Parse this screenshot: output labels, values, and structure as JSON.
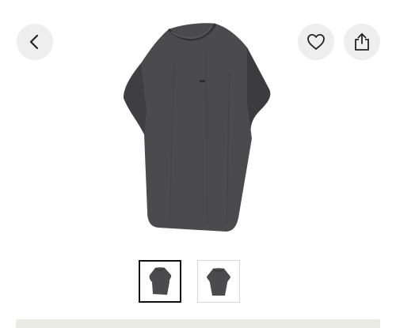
{
  "product": {
    "image_icon": "tshirt-image",
    "garment_color": "#4a4a4c"
  },
  "header": {
    "back_icon": "chevron-left-icon",
    "favorite_icon": "heart-icon",
    "share_icon": "share-icon"
  },
  "gallery": {
    "thumbnails": [
      {
        "icon": "tshirt-thumbnail",
        "selected": true
      },
      {
        "icon": "tshirt-thumbnail",
        "selected": false
      }
    ]
  },
  "colors": {
    "button_bg": "#eeeeee",
    "selected_border": "#111111",
    "bottom_bar": "#ebebe6"
  }
}
